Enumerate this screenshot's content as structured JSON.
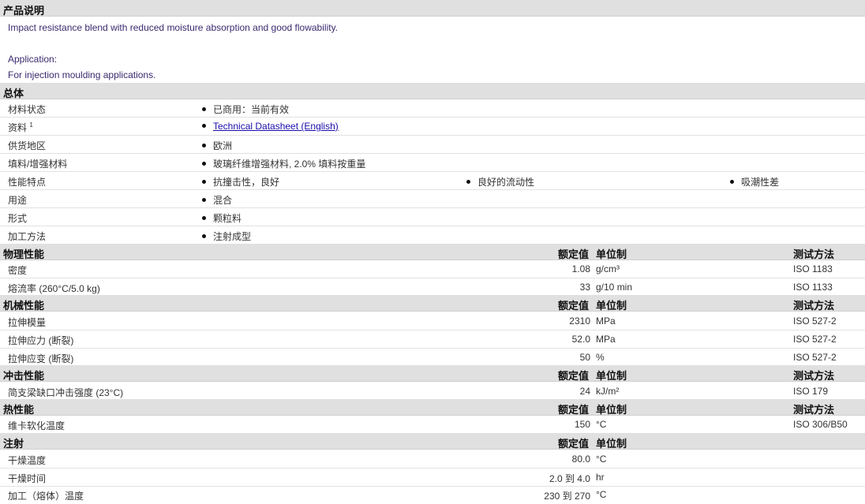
{
  "product": {
    "heading": "产品说明",
    "desc1": "Impact resistance blend with reduced moisture absorption and good flowability.",
    "desc2": "Application:",
    "desc3": "For injection moulding applications."
  },
  "general": {
    "heading": "总体",
    "rows": [
      {
        "label": "材料状态",
        "value": "已商用：当前有效"
      },
      {
        "label": "资料",
        "sup": "1",
        "value": "Technical Datasheet (English)"
      },
      {
        "label": "供货地区",
        "value": "欧洲"
      },
      {
        "label": "填料/增强材料",
        "value": "玻璃纤维增强材料, 2.0% 填料按重量"
      },
      {
        "label": "性能特点",
        "values": [
          "抗撞击性，良好",
          "良好的流动性",
          "吸潮性差"
        ]
      },
      {
        "label": "用途",
        "value": "混合"
      },
      {
        "label": "形式",
        "value": "颗粒料"
      },
      {
        "label": "加工方法",
        "value": "注射成型"
      }
    ]
  },
  "col_headers": {
    "value": "额定值",
    "unit": "单位制",
    "test": "测试方法"
  },
  "physical": {
    "heading": "物理性能",
    "rows": [
      {
        "label": "密度",
        "value": "1.08",
        "unit": "g/cm³",
        "test": "ISO 1183"
      },
      {
        "label": "熔流率 (260°C/5.0 kg)",
        "value": "33",
        "unit": "g/10 min",
        "test": "ISO 1133"
      }
    ]
  },
  "mechanical": {
    "heading": "机械性能",
    "rows": [
      {
        "label": "拉伸模量",
        "value": "2310",
        "unit": "MPa",
        "test": "ISO 527-2"
      },
      {
        "label": "拉伸应力 (断裂)",
        "value": "52.0",
        "unit": "MPa",
        "test": "ISO 527-2"
      },
      {
        "label": "拉伸应变 (断裂)",
        "value": "50",
        "unit": "%",
        "test": "ISO 527-2"
      }
    ]
  },
  "impact": {
    "heading": "冲击性能",
    "rows": [
      {
        "label": "简支梁缺口冲击强度 (23°C)",
        "value": "24",
        "unit": "kJ/m²",
        "test": "ISO 179"
      }
    ]
  },
  "thermal": {
    "heading": "热性能",
    "rows": [
      {
        "label": "维卡软化温度",
        "value": "150",
        "unit": "°C",
        "test": "ISO 306/B50"
      }
    ]
  },
  "injection": {
    "heading": "注射",
    "rows": [
      {
        "label": "干燥温度",
        "value": "80.0",
        "unit": "°C"
      },
      {
        "label": "干燥时间",
        "value": "2.0 到  4.0",
        "unit": "hr"
      },
      {
        "label": "加工（熔体）温度",
        "value": "230 到  270",
        "unit": "°C"
      }
    ]
  }
}
